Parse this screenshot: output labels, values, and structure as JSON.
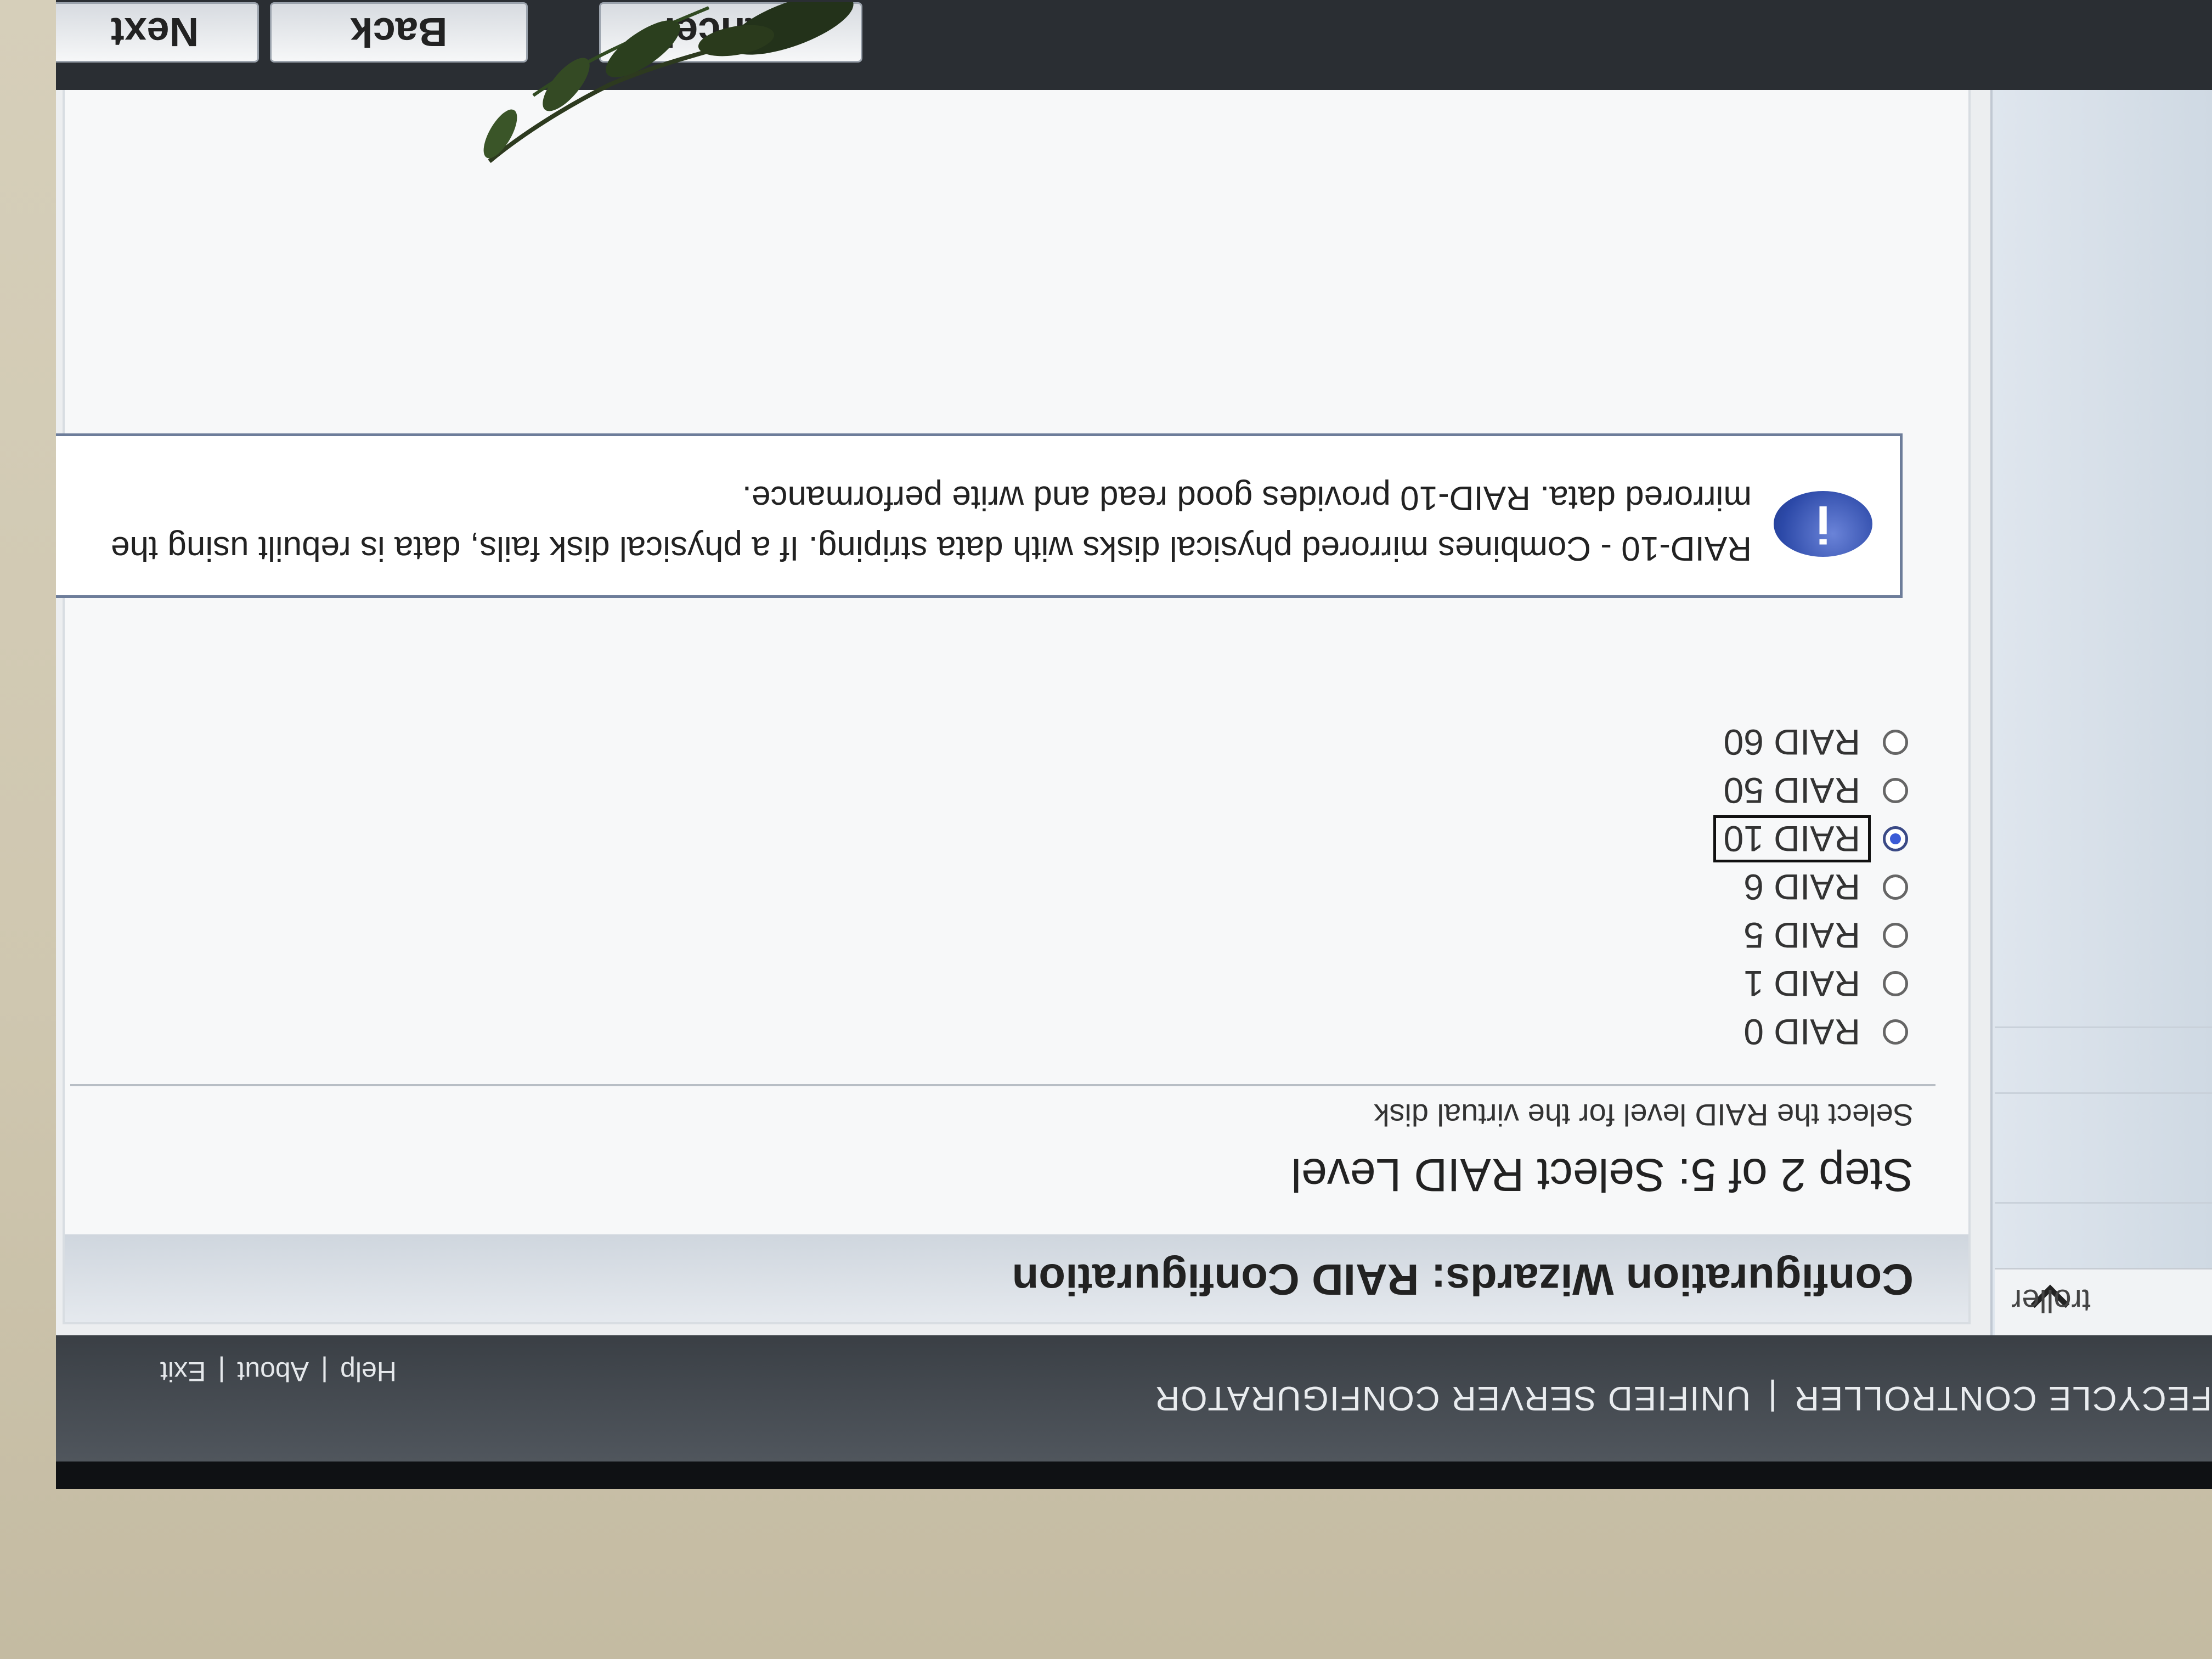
{
  "header": {
    "brand_left": "FECYCLE CONTROLLER",
    "brand_sep": "|",
    "brand_right": "UNIFIED SERVER CONFIGURATOR",
    "links": [
      "Help",
      "About",
      "Exit"
    ],
    "link_sep": "|"
  },
  "sidebar": {
    "heading": "troller",
    "heading_icon": "chevron-down-icon"
  },
  "wizard": {
    "title": "Configuration Wizards: RAID Configuration",
    "step_title": "Step 2 of 5: Select RAID Level",
    "step_description": "Select the RAID level for the virtual disk",
    "options": [
      "RAID 0",
      "RAID 1",
      "RAID 5",
      "RAID 6",
      "RAID 10",
      "RAID 50",
      "RAID 60"
    ],
    "selected_option": "RAID 10",
    "info": {
      "icon": "info-icon",
      "text": "RAID-10 - Combines mirrored physical disks with data striping. If a physical disk fails, data is rebuilt using the mirrored data. RAID-10 provides good read and write performance."
    }
  },
  "buttons": {
    "cancel": "Cancel",
    "back": "Back",
    "next": "Next"
  },
  "colors": {
    "header_bg": "#3f454b",
    "info_icon": "#2c49a8",
    "radio_selected": "#3b5bd6"
  }
}
